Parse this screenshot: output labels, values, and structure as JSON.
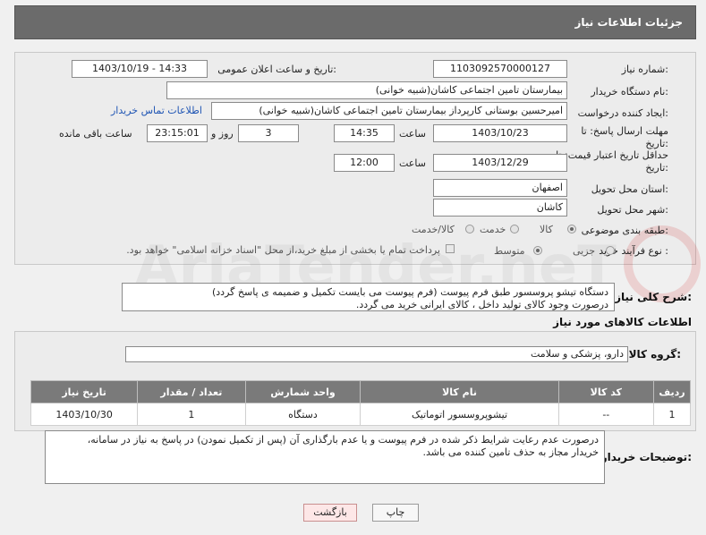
{
  "header": {
    "title": "جزئیات اطلاعات نیاز"
  },
  "labels": {
    "need_number": "شماره نیاز:",
    "announce_datetime": "تاریخ و ساعت اعلان عمومی:",
    "buyer_org": "نام دستگاه خریدار:",
    "creator": "ایجاد کننده درخواست:",
    "send_deadline": "مهلت ارسال پاسخ: تا",
    "send_deadline_2": "تاریخ:",
    "time_word": "ساعت",
    "day_and": "روز و",
    "hours_remaining": "ساعت باقی مانده",
    "price_validity": "حداقل تاریخ اعتبار قیمت: تا",
    "price_validity_2": "تاریخ:",
    "province": "استان محل تحویل:",
    "city": "شهر محل تحویل:",
    "category": "طبقه بندی موضوعی:",
    "purchase_type": "نوع فرآیند خرید :",
    "general_desc": "شرح کلی نیاز:",
    "goods_info": "اطلاعات کالاهای مورد نیاز",
    "goods_group": "گروه کالا:",
    "buyer_notes": "توضیحات خریدار:"
  },
  "values": {
    "need_number": "1103092570000127",
    "announce_datetime": "1403/10/19 - 14:33",
    "buyer_org": "بیمارستان تامین اجتماعی کاشان(شبیه خوانی)",
    "creator": "امیرحسین بوستانی کارپرداز بیمارستان تامین اجتماعی کاشان(شبیه خوانی)",
    "contact_link": "اطلاعات تماس خریدار",
    "send_date": "1403/10/23",
    "send_time": "14:35",
    "days": "3",
    "remaining": "23:15:01",
    "validity_date": "1403/12/29",
    "validity_time": "12:00",
    "province": "اصفهان",
    "city": "کاشان",
    "goods_group": "دارو، پزشکی و سلامت"
  },
  "category_options": [
    "کالا",
    "خدمت",
    "کالا/خدمت"
  ],
  "purchase_options": [
    "جزیی",
    "متوسط"
  ],
  "purchase_note": "پرداخت تمام یا بخشی از مبلغ خرید،از محل \"اسناد خزانه اسلامی\" خواهد بود.",
  "general_desc_lines": [
    "دستگاه تیشو پروسسور طبق فرم پیوست (فرم پیوست می بایست تکمیل و ضمیمه ی پاسخ گردد)",
    "درصورت وجود کالای تولید داخل ، کالای ایرانی خرید می گردد."
  ],
  "table": {
    "headers": [
      "ردیف",
      "کد کالا",
      "نام کالا",
      "واحد شمارش",
      "تعداد / مقدار",
      "تاریخ نیاز"
    ],
    "rows": [
      [
        "1",
        "--",
        "تیشوپروسسور اتوماتیک",
        "دستگاه",
        "1",
        "1403/10/30"
      ]
    ]
  },
  "buyer_notes_lines": [
    "درصورت عدم رعایت شرایط ذکر شده در فرم پیوست و یا عدم بارگذاری آن (پس از تکمیل نمودن) در پاسخ به نیاز در سامانه،",
    "خریدار مجاز به حذف تامین کننده می باشد."
  ],
  "buttons": {
    "print": "چاپ",
    "back": "بازگشت"
  },
  "watermark": "AriaTender.neT",
  "colors": {
    "header_bg": "#6b6b6b",
    "link": "#1f55b4",
    "table_header": "#7a7a7a"
  }
}
